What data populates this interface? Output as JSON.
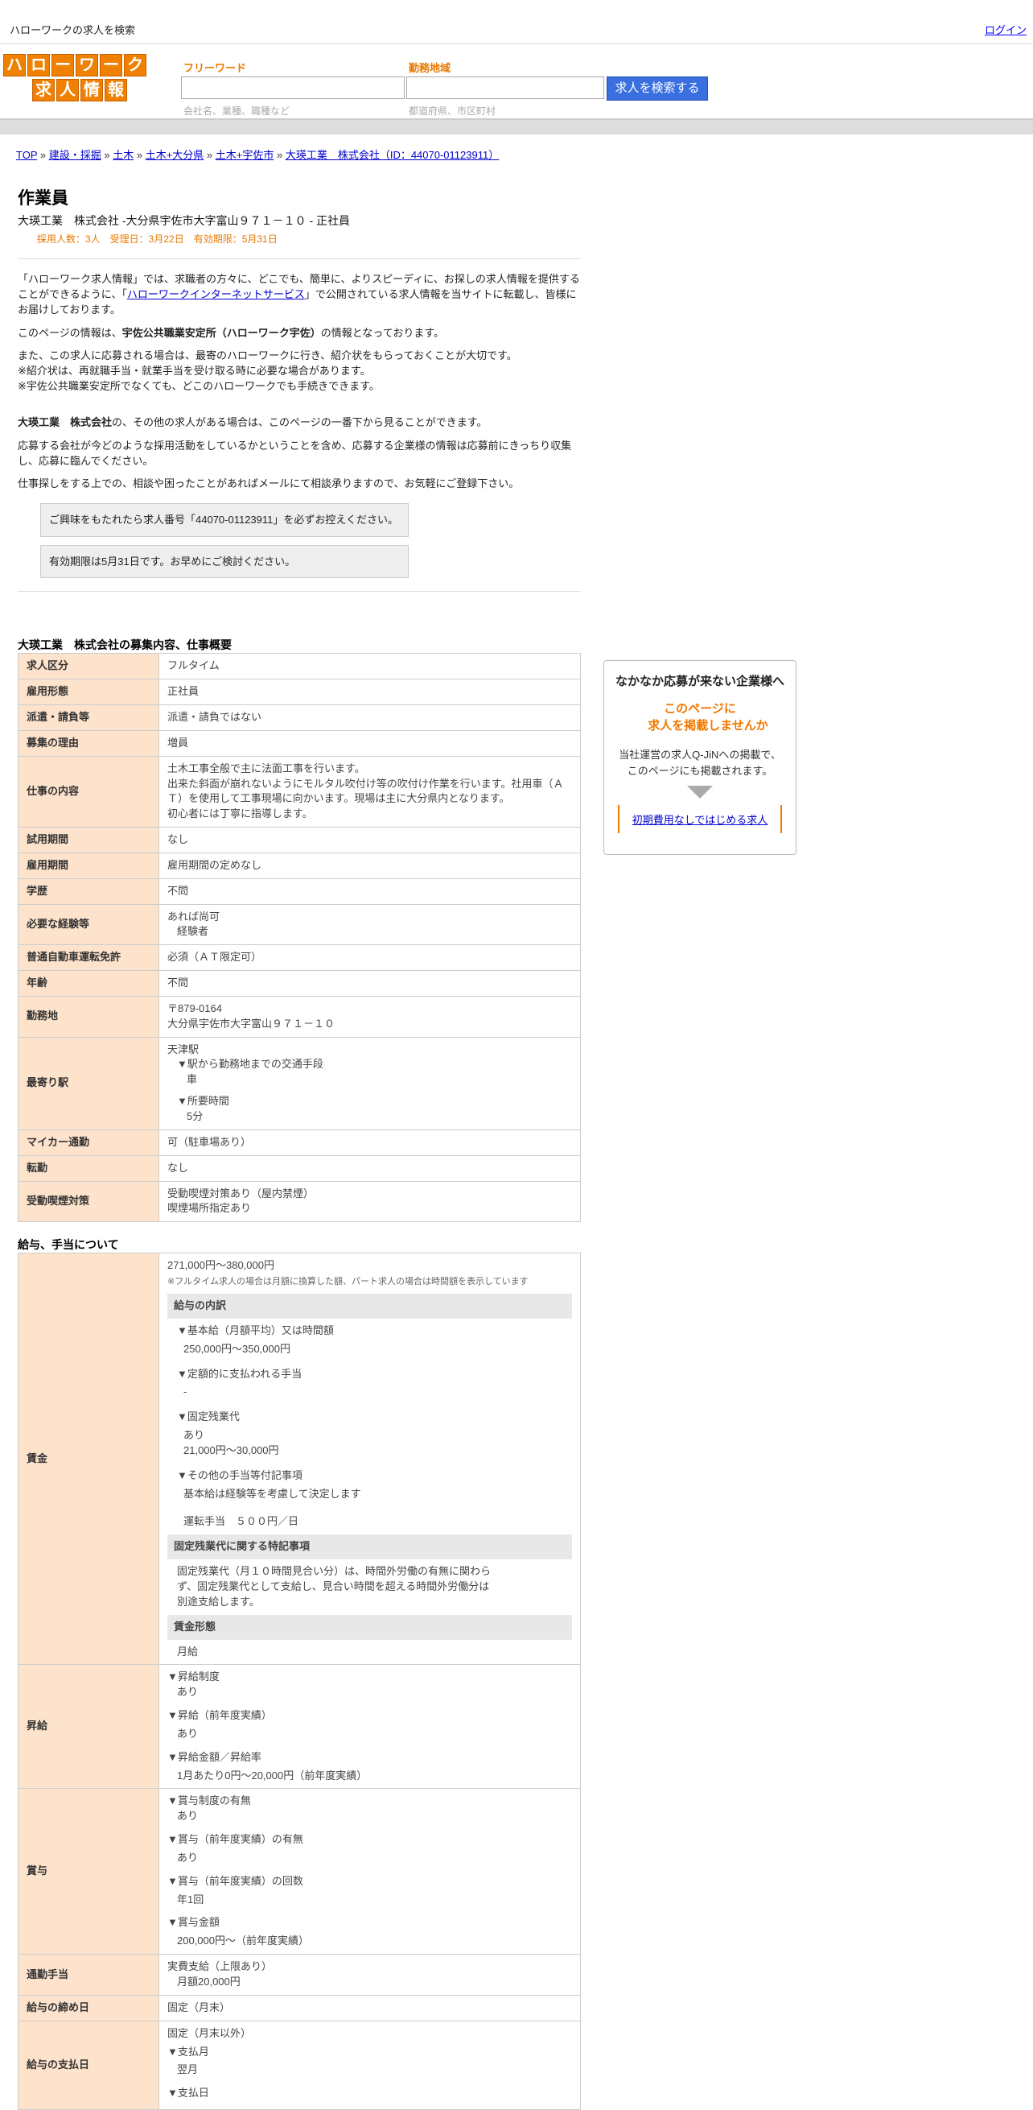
{
  "top": {
    "site_title": "ハローワークの求人を検索",
    "login": "ログイン"
  },
  "logo": {
    "row1": [
      "ハ",
      "ロ",
      "ー",
      "ワ",
      "ー",
      "ク"
    ],
    "row2": [
      "求",
      "人",
      "情",
      "報"
    ]
  },
  "search": {
    "keyword_label": "フリーワード",
    "keyword_placeholder": "会社名、業種、職種など",
    "area_label": "勤務地域",
    "area_placeholder": "都道府県、市区町村",
    "button": "求人を検索する"
  },
  "breadcrumb": [
    "TOP",
    "建設・採掘",
    "土木",
    "土木+大分県",
    "土木+宇佐市",
    "大瑛工業　株式会社（ID：44070-01123911）"
  ],
  "job": {
    "title": "作業員",
    "company_line": "大瑛工業　株式会社 -大分県宇佐市大字富山９７１－１０ - 正社員",
    "meta": "採用人数：3人　受理日：3月22日　有効期限：5月31日"
  },
  "intro": {
    "p1a": "「ハローワーク求人情報」では、求職者の方々に、どこでも、簡単に、よりスピーディに、お探しの求人情報を提供することができるように、「",
    "p1link": "ハローワークインターネットサービス",
    "p1b": "」で公開されている求人情報を当サイトに転載し、皆様にお届けしております。",
    "p2a": "このページの情報は、",
    "p2b": "宇佐公共職業安定所（ハローワーク宇佐）",
    "p2c": "の情報となっております。",
    "p3": "また、この求人に応募される場合は、最寄のハローワークに行き、紹介状をもらっておくことが大切です。",
    "p4": "※紹介状は、再就職手当・就業手当を受け取る時に必要な場合があります。",
    "p5": "※宇佐公共職業安定所でなくても、どこのハローワークでも手続きできます。",
    "p6a": "大瑛工業　株式会社",
    "p6b": "の、その他の求人がある場合は、このページの一番下から見ることができます。",
    "p7": "応募する会社が今どのような採用活動をしているかということを含め、応募する企業様の情報は応募前にきっちり収集し、応募に臨んでください。",
    "p8": "仕事探しをする上での、相談や困ったことがあればメールにて相談承りますので、お気軽にご登録下さい。",
    "notice1": "ご興味をもたれたら求人番号「44070-01123911」を必ずお控えください。",
    "notice2": "有効期限は5月31日です。お早めにご検討ください。"
  },
  "overview": {
    "heading": "大瑛工業　株式会社の募集内容、仕事概要",
    "rows": [
      {
        "k": "求人区分",
        "v": "フルタイム"
      },
      {
        "k": "雇用形態",
        "v": "正社員"
      },
      {
        "k": "派遣・請負等",
        "v": "派遣・請負ではない"
      },
      {
        "k": "募集の理由",
        "v": "増員"
      },
      {
        "k": "仕事の内容",
        "v": "土木工事全般で主に法面工事を行います。\n出来た斜面が崩れないようにモルタル吹付け等の吹付け作業を行います。社用車（ＡＴ）を使用して工事現場に向かいます。現場は主に大分県内となります。\n初心者には丁寧に指導します。"
      },
      {
        "k": "試用期間",
        "v": "なし"
      },
      {
        "k": "雇用期間",
        "v": "雇用期間の定めなし"
      },
      {
        "k": "学歴",
        "v": "不問"
      },
      {
        "k": "必要な経験等",
        "v": "あれば尚可",
        "v2": "経験者"
      },
      {
        "k": "普通自動車運転免許",
        "v": "必須（ＡＴ限定可）"
      },
      {
        "k": "年齢",
        "v": "不問"
      },
      {
        "k": "勤務地",
        "v": "〒879-0164\n大分県宇佐市大字富山９７１－１０"
      },
      {
        "k": "最寄り駅",
        "v": "天津駅",
        "s1": "▼駅から勤務地までの交通手段",
        "s1v": "車",
        "s2": "▼所要時間",
        "s2v": "5分"
      },
      {
        "k": "マイカー通勤",
        "v": "可（駐車場あり）"
      },
      {
        "k": "転勤",
        "v": "なし"
      },
      {
        "k": "受動喫煙対策",
        "v": "受動喫煙対策あり（屋内禁煙）\n喫煙場所指定あり"
      }
    ]
  },
  "salary": {
    "heading": "給与、手当について",
    "wage_label": "賃金",
    "wage_range": "271,000円〜380,000円",
    "wage_note": "※フルタイム求人の場合は月額に換算した額、パート求人の場合は時間額を表示しています",
    "breakdown_h": "給与の内訳",
    "b1": "▼基本給（月額平均）又は時間額",
    "b1v": "250,000円〜350,000円",
    "b2": "▼定額的に支払われる手当",
    "b2v": "-",
    "b3": "▼固定残業代",
    "b3v": "あり",
    "b3v2": "21,000円〜30,000円",
    "b4": "▼その他の手当等付記事項",
    "b4v": "基本給は経験等を考慮して決定します",
    "b4v2": "運転手当　５００円／日",
    "fixed_h": "固定残業代に関する特記事項",
    "fixed_v": "固定残業代（月１０時間見合い分）は、時間外労働の有無に関わらず、固定残業代として支給し、見合い時間を超える時間外労働分は別途支給します。",
    "form_h": "賃金形態",
    "form_v": "月給",
    "raise_label": "昇給",
    "r1": "▼昇給制度",
    "r1v": "あり",
    "r2": "▼昇給（前年度実績）",
    "r2v": "あり",
    "r3": "▼昇給金額／昇給率",
    "r3v": "1月あたり0円〜20,000円（前年度実績）",
    "bonus_label": "賞与",
    "bo1": "▼賞与制度の有無",
    "bo1v": "あり",
    "bo2": "▼賞与（前年度実績）の有無",
    "bo2v": "あり",
    "bo3": "▼賞与（前年度実績）の回数",
    "bo3v": "年1回",
    "bo4": "▼賞与金額",
    "bo4v": "200,000円〜（前年度実績）",
    "commute_label": "通勤手当",
    "commute_v": "実費支給（上限あり）",
    "commute_v2": "月額20,000円",
    "close_label": "給与の締め日",
    "close_v": "固定（月末）",
    "pay_label": "給与の支払日",
    "pay_v": "固定（月末以外）",
    "pay_s1": "▼支払月",
    "pay_s1v": "翌月",
    "pay_s2": "▼支払日"
  },
  "ad": {
    "title": "なかなか応募が来ない企業様へ",
    "offer1": "このページに",
    "offer2": "求人を掲載しませんか",
    "desc1": "当社運営の求人Q-JiNへの掲載で、",
    "desc2": "このページにも掲載されます。",
    "link": "初期費用なしではじめる求人"
  }
}
